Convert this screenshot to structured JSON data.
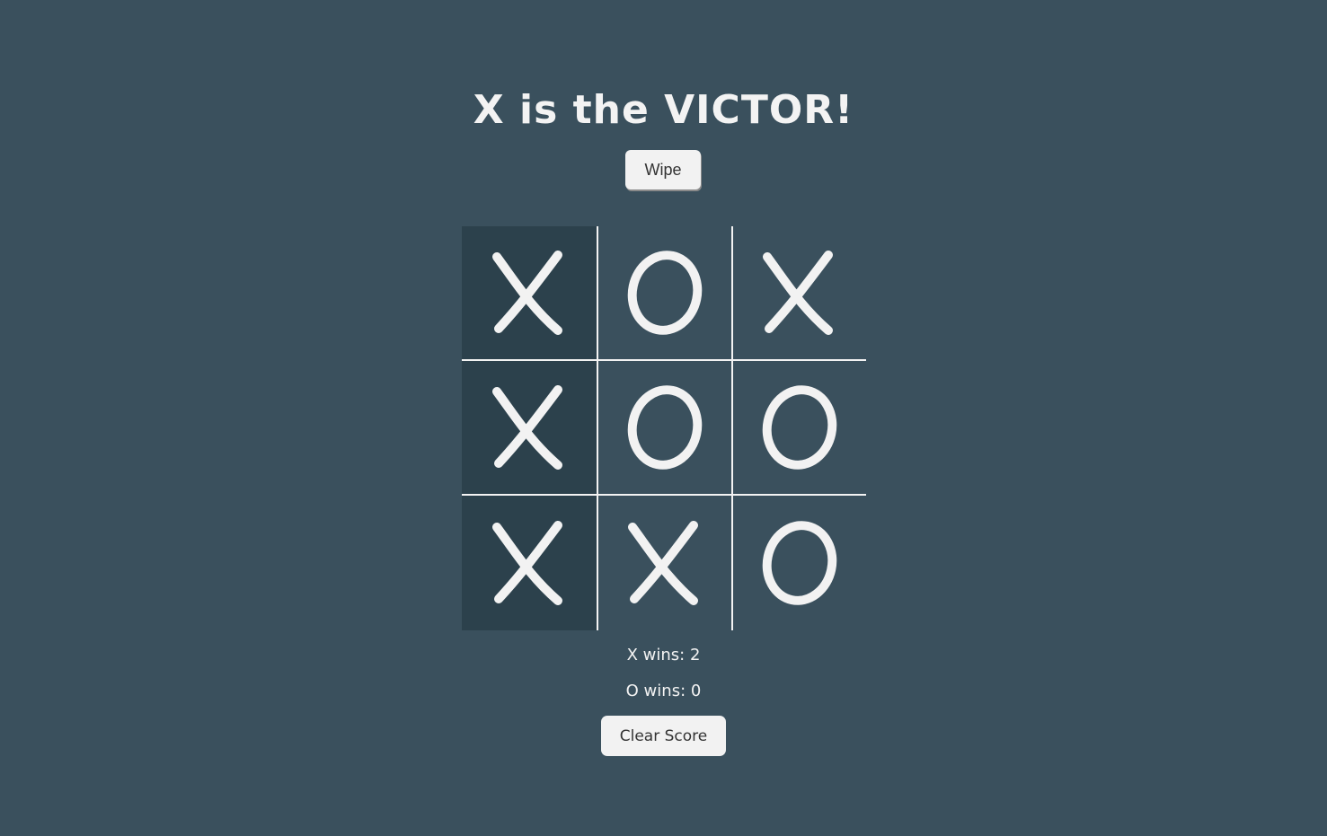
{
  "status": {
    "message": "X is the VICTOR!"
  },
  "controls": {
    "wipe_label": "Wipe",
    "clear_score_label": "Clear Score"
  },
  "board": {
    "cells": [
      "X",
      "O",
      "X",
      "X",
      "O",
      "O",
      "X",
      "X",
      "O"
    ],
    "winning_cells": [
      0,
      3,
      6
    ]
  },
  "scores": {
    "x_label": "X wins: 2",
    "o_label": "O wins: 0"
  },
  "colors": {
    "background": "#3a505d",
    "winning_cell": "#2c414c",
    "foreground": "#f3f3f3"
  }
}
